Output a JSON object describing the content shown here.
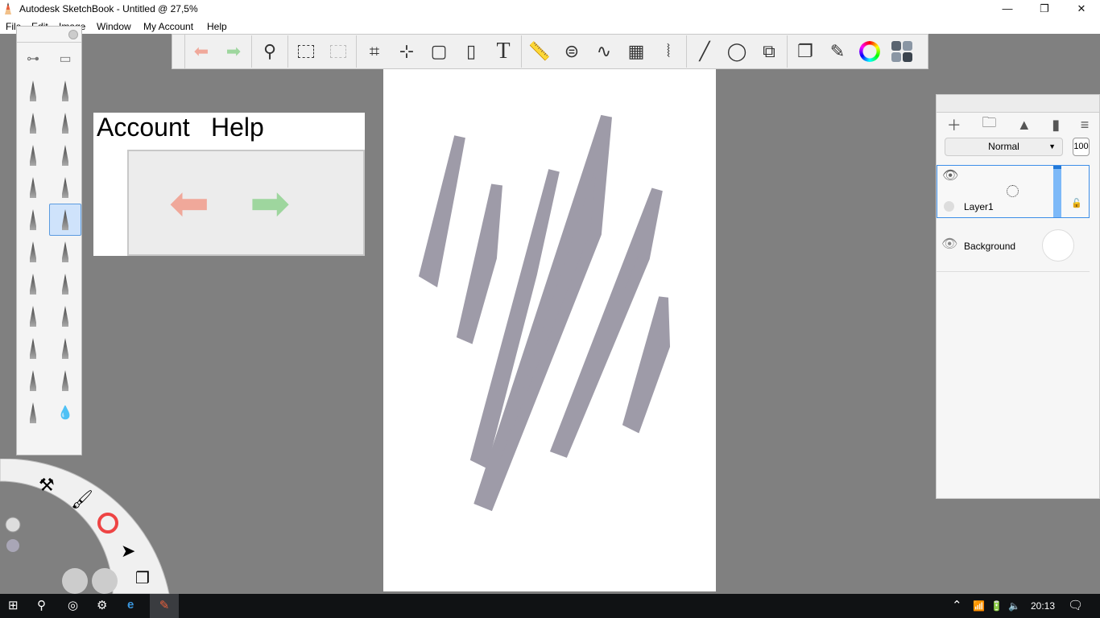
{
  "window": {
    "title": "Autodesk SketchBook - Untitled @ 27,5%",
    "minimize": "—",
    "restore": "❐",
    "close": "✕"
  },
  "menu": [
    "File",
    "Edit",
    "Image",
    "Window",
    "My Account",
    "Help"
  ],
  "zoom_preview": {
    "items": [
      "Account",
      "Help"
    ]
  },
  "toolbar": {
    "icons": [
      "undo-icon",
      "redo-icon",
      "zoom-icon",
      "select-icon",
      "clear-selection-icon",
      "crop-icon",
      "transform-icon",
      "distort-icon",
      "fill-icon",
      "text-icon",
      "ruler-icon",
      "ellipse-guide-icon",
      "french-curve-icon",
      "perspective-icon",
      "symmetry-icon",
      "line-icon",
      "circle-icon",
      "shape-icon",
      "layers-icon",
      "brushes-icon",
      "color-wheel-icon",
      "copic-library-icon"
    ]
  },
  "layers": {
    "blend_mode": "Normal",
    "opacity": "100",
    "items": [
      {
        "name": "Layer1",
        "selected": true
      },
      {
        "name": "Background",
        "selected": false
      }
    ]
  },
  "taskbar": {
    "clock": "20:13"
  },
  "colors": {
    "stroke": "#9e9ba8",
    "accent": "#3d8ee8"
  }
}
